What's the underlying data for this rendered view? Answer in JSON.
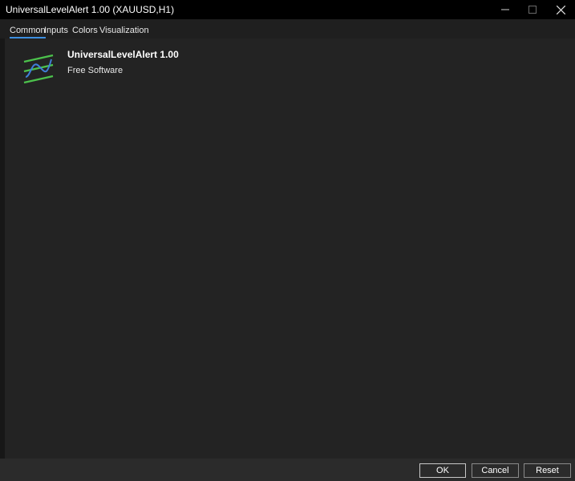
{
  "window": {
    "title": "UniversalLevelAlert 1.00 (XAUUSD,H1)"
  },
  "tabs": [
    {
      "label": "Common",
      "active": true
    },
    {
      "label": "Inputs",
      "active": false
    },
    {
      "label": "Colors",
      "active": false
    },
    {
      "label": "Visualization",
      "active": false
    }
  ],
  "product": {
    "name": "UniversalLevelAlert 1.00",
    "license": "Free Software",
    "icon": "indicator-wave-icon"
  },
  "footer": {
    "ok_label": "OK",
    "cancel_label": "Cancel",
    "reset_label": "Reset"
  },
  "colors": {
    "accent": "#3d8fe0",
    "logo_green": "#4cc24c",
    "logo_blue": "#3f7fd8"
  }
}
